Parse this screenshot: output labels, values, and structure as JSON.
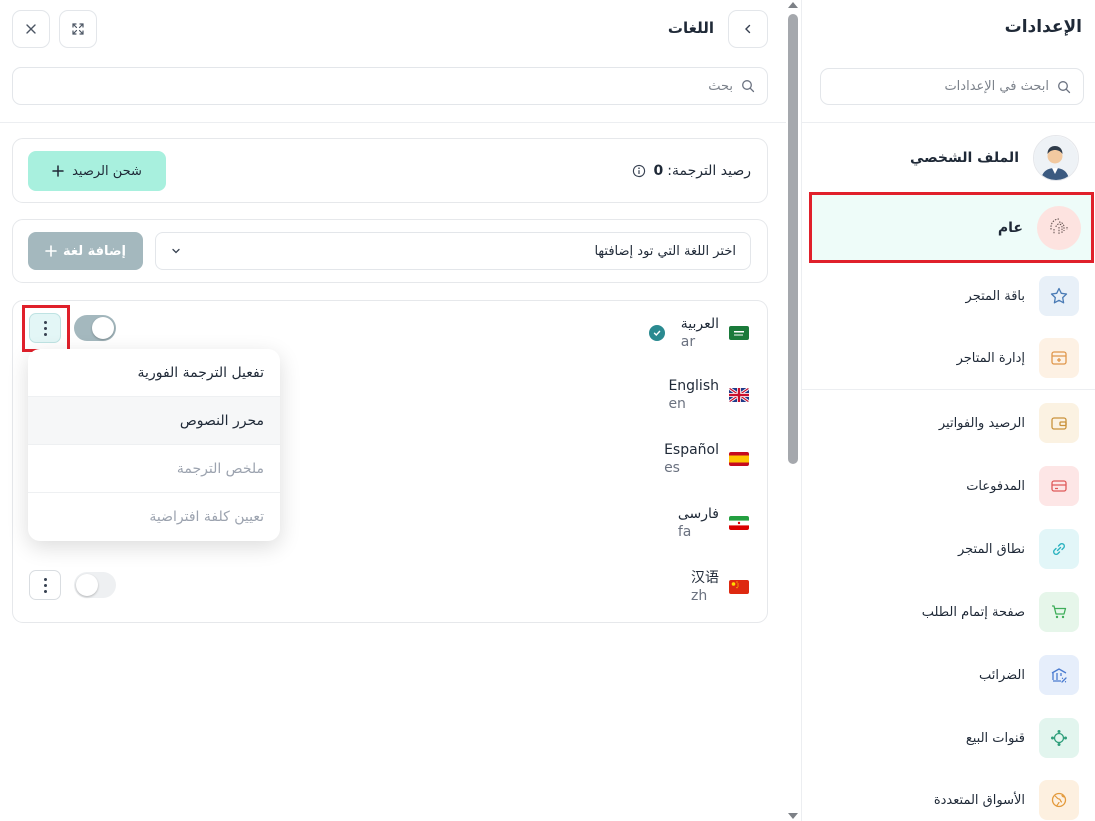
{
  "sidebar": {
    "title": "الإعدادات",
    "search_placeholder": "ابحث في الإعدادات",
    "profile_label": "الملف الشخصي",
    "general_label": "عام",
    "items": [
      {
        "label": "باقة المتجر",
        "icon": "star-icon",
        "color": "#4a7bb5",
        "bg": "#e8f0f8"
      },
      {
        "label": "إدارة المتاجر",
        "icon": "store-icon",
        "color": "#e0964a",
        "bg": "#fdf1e4"
      },
      {
        "label": "الرصيد والفواتير",
        "icon": "wallet-icon",
        "color": "#c9923b",
        "bg": "#fbf2e2"
      },
      {
        "label": "المدفوعات",
        "icon": "credit-card-icon",
        "color": "#e05a5a",
        "bg": "#fde6e6"
      },
      {
        "label": "نطاق المتجر",
        "icon": "link-icon",
        "color": "#2bb3c0",
        "bg": "#e2f6f8"
      },
      {
        "label": "صفحة إتمام الطلب",
        "icon": "cart-icon",
        "color": "#3fae5a",
        "bg": "#e6f6ea"
      },
      {
        "label": "الضرائب",
        "icon": "tax-icon",
        "color": "#4a7bd0",
        "bg": "#e6eefb"
      },
      {
        "label": "قنوات البيع",
        "icon": "channels-icon",
        "color": "#2e9e7a",
        "bg": "#e2f5ee"
      },
      {
        "label": "الأسواق المتعددة",
        "icon": "globe-icon",
        "color": "#e39a3c",
        "bg": "#fdf0e0"
      }
    ]
  },
  "panel": {
    "title": "اللغات",
    "search_placeholder": "بحث",
    "balance_label": "رصيد الترجمة:",
    "balance_value": "0",
    "recharge_label": "شحن الرصيد",
    "select_placeholder": "اختر اللغة التي تود إضافتها",
    "add_language_label": "إضافة لغة",
    "languages": [
      {
        "name": "العربية",
        "code": "ar",
        "flag": "flag-saudi-icon"
      },
      {
        "name": "English",
        "code": "en",
        "flag": "flag-uk-icon"
      },
      {
        "name": "Español",
        "code": "es",
        "flag": "flag-spain-icon"
      },
      {
        "name": "فارسی",
        "code": "fa",
        "flag": "flag-iran-icon"
      },
      {
        "name": "汉语",
        "code": "zh",
        "flag": "flag-china-icon"
      }
    ],
    "menu_items": [
      {
        "label": "تفعيل الترجمة الفورية"
      },
      {
        "label": "محرر النصوص"
      },
      {
        "label": "ملخص الترجمة"
      },
      {
        "label": "تعيين كلفة افتراضية"
      }
    ]
  },
  "colors": {
    "accent": "#2a8a90",
    "highlight_border": "#e0202b",
    "recharge_bg": "#a8f0de",
    "toggle_on": "#a4b8be",
    "toggle_off": "#eef0f2"
  }
}
